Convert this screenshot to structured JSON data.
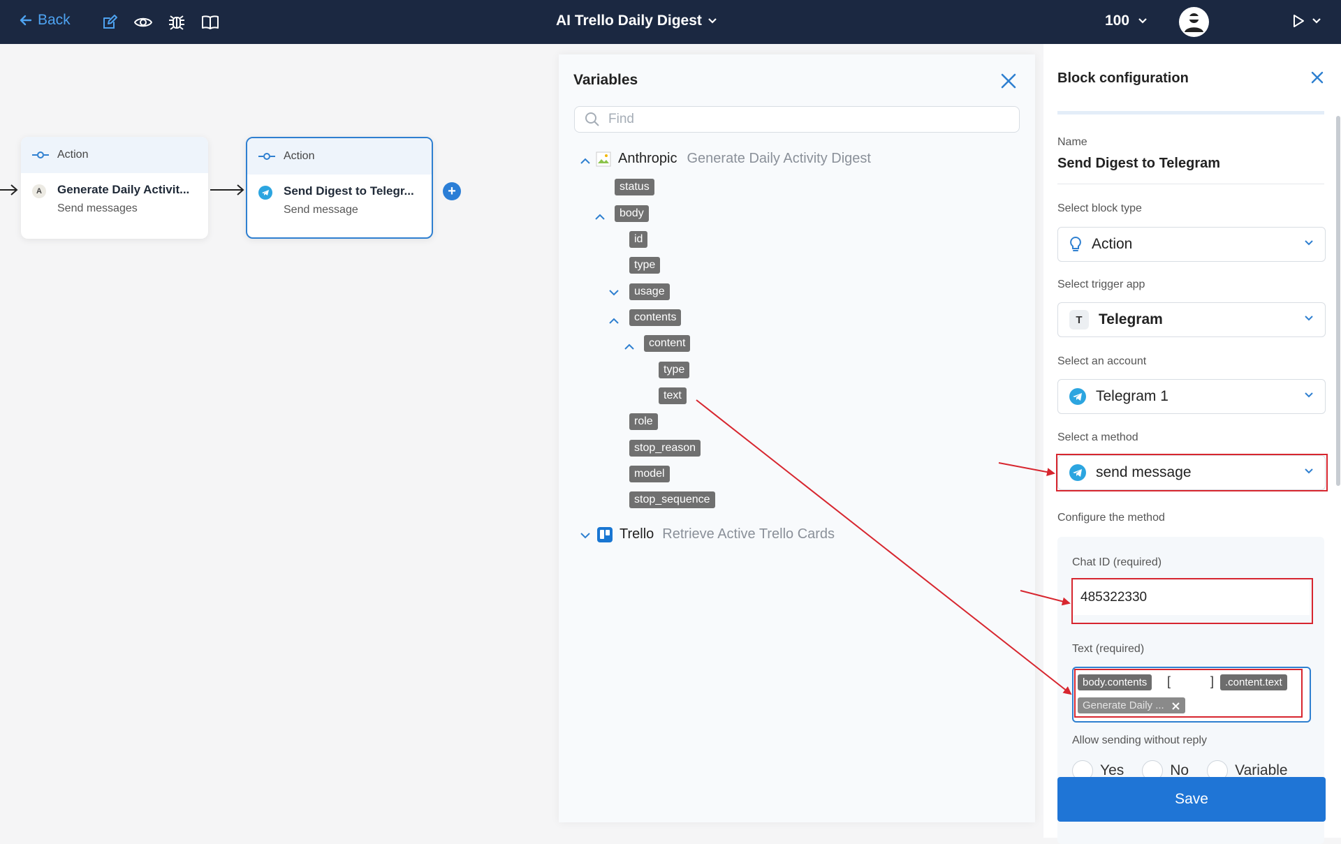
{
  "topbar": {
    "back_label": "Back",
    "title": "AI Trello Daily Digest",
    "zoom": "100",
    "icons": [
      "edit-icon",
      "eye-icon",
      "bug-icon",
      "book-icon"
    ]
  },
  "canvas": {
    "nodes": [
      {
        "kind": "Action",
        "badge": "A",
        "title": "Generate Daily Activit...",
        "subtitle": "Send messages"
      },
      {
        "kind": "Action",
        "title": "Send Digest to Telegr...",
        "subtitle": "Send message"
      }
    ]
  },
  "variables": {
    "title": "Variables",
    "search_placeholder": "Find",
    "sources": [
      {
        "name": "Anthropic",
        "description": "Generate Daily Activity Digest"
      },
      {
        "name": "Trello",
        "description": "Retrieve Active Trello Cards"
      }
    ],
    "tree": {
      "status": "status",
      "body": "body",
      "id": "id",
      "type": "type",
      "usage": "usage",
      "contents": "contents",
      "content": "content",
      "content_type": "type",
      "text": "text",
      "role": "role",
      "stop_reason": "stop_reason",
      "model": "model",
      "stop_sequence": "stop_sequence"
    }
  },
  "config": {
    "title": "Block configuration",
    "name_label": "Name",
    "name_value": "Send Digest to Telegram",
    "block_type_label": "Select block type",
    "block_type_value": "Action",
    "trigger_app_label": "Select trigger app",
    "trigger_app_badge": "T",
    "trigger_app_value": "Telegram",
    "account_label": "Select an account",
    "account_value": "Telegram 1",
    "method_label": "Select a method",
    "method_value": "send message",
    "configure_label": "Configure the method",
    "chat_id_label": "Chat ID (required)",
    "chat_id_value": "485322330",
    "text_label": "Text (required)",
    "text_token_1": "body.contents",
    "text_bracket_open": "[",
    "text_bracket_close": "]",
    "text_token_2": ".content.text",
    "text_source_chip": "Generate Daily ...",
    "reply_label": "Allow sending without reply",
    "reply_options": [
      "Yes",
      "No",
      "Variable"
    ],
    "save_label": "Save"
  },
  "colors": {
    "topbar_bg": "#1b2841",
    "accent": "#1f75d6",
    "tag_bg": "#707070",
    "annotation_red": "#d7262f"
  }
}
